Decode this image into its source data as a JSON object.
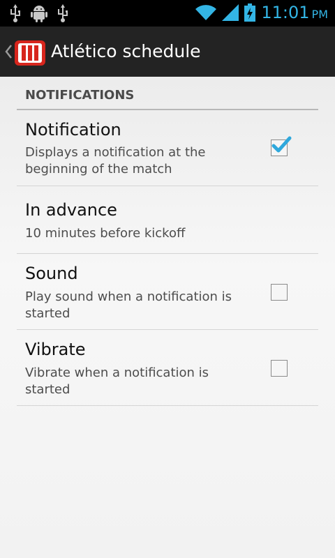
{
  "statusbar": {
    "icons": [
      "usb-icon",
      "android-debug-icon",
      "usb-icon",
      "wifi-icon",
      "signal-icon",
      "battery-charging-icon"
    ],
    "time": "11:01",
    "ampm": "PM"
  },
  "actionbar": {
    "title": "Atlético schedule",
    "back_icon": "chevron-left-icon",
    "app_icon": "stadium-icon"
  },
  "section": {
    "header": "NOTIFICATIONS"
  },
  "preferences": [
    {
      "title": "Notification",
      "summary": "Displays a notification at the beginning of the match",
      "checked": true
    },
    {
      "title": "In advance",
      "summary": "10 minutes before kickoff"
    },
    {
      "title": "Sound",
      "summary": "Play sound when a notification is started",
      "checked": false
    },
    {
      "title": "Vibrate",
      "summary": "Vibrate when a notification is started",
      "checked": false
    }
  ],
  "colors": {
    "accent": "#33b5e5",
    "actionbar": "#232323",
    "app_icon_red": "#d7261d"
  }
}
